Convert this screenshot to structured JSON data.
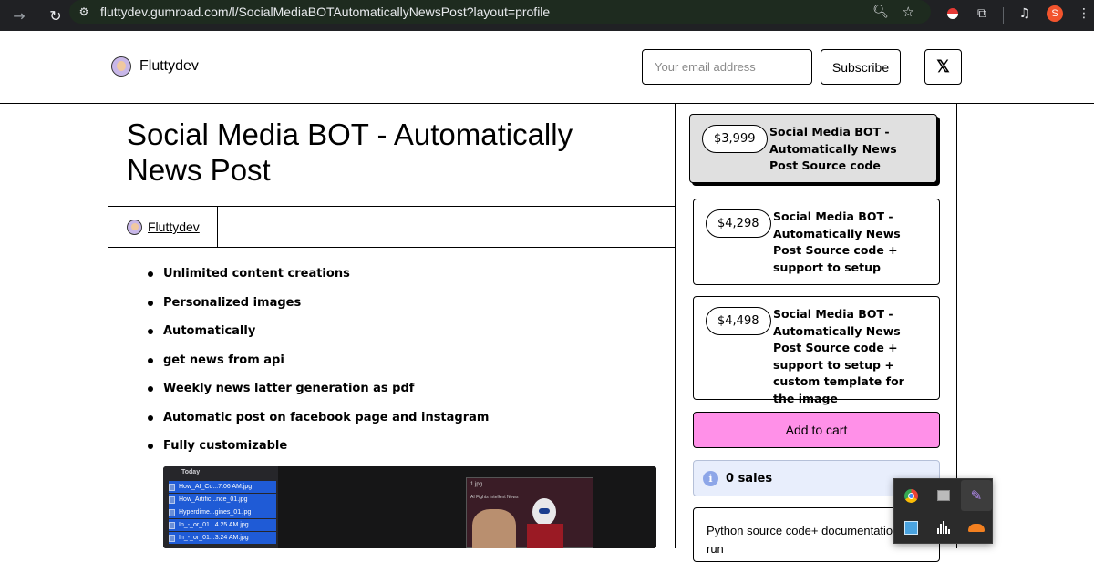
{
  "browser": {
    "url": "fluttydev.gumroad.com/l/SocialMediaBOTAutomaticallyNewsPost?layout=profile",
    "avatar_letter": "S"
  },
  "header": {
    "brand_name": "Fluttydev",
    "email_placeholder": "Your email address",
    "subscribe_label": "Subscribe",
    "x_label": "𝕏"
  },
  "product": {
    "title": "Social Media BOT - Automatically News Post",
    "seller": "Fluttydev",
    "features": [
      "Unlimited content creations",
      "Personalized images",
      "Automatically",
      "get news from api",
      "Weekly news latter generation as pdf",
      "Automatic post on facebook page and instagram",
      "Fully customizable"
    ]
  },
  "preview": {
    "today_label": "Today",
    "files": [
      "How_AI_Co...7.06 AM.jpg",
      "How_Artific...nce_01.jpg",
      "Hyperdime...gines_01.jpg",
      "In_-_or_01...4.25 AM.jpg",
      "In_-_or_01...3.24 AM.jpg"
    ],
    "image_filename": "1.jpg",
    "image_caption": "AI Fights Intellent News"
  },
  "tiers": [
    {
      "price": "$3,999",
      "name": "Social Media BOT - Automatically News Post Source code",
      "selected": true
    },
    {
      "price": "$4,298",
      "name": "Social Media BOT - Automatically News Post Source code + support to setup",
      "selected": false
    },
    {
      "price": "$4,498",
      "name": "Social Media BOT - Automatically News Post Source code + support to setup + custom template for the image",
      "selected": false
    }
  ],
  "cart": {
    "label": "Add to cart"
  },
  "sales": {
    "text": "0 sales",
    "icon": "info-icon"
  },
  "description": {
    "text": "Python source code+ documentation to run"
  },
  "colors": {
    "cart_bg": "#ff90e8",
    "sales_bg": "#e8eefc",
    "selected_tier_bg": "#e0e0e0"
  }
}
